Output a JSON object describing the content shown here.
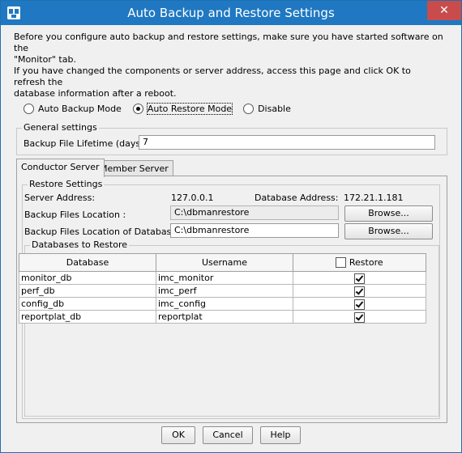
{
  "window": {
    "title": "Auto Backup and Restore Settings",
    "close_glyph": "✕"
  },
  "info": {
    "line1": "Before you configure auto backup and restore settings, make sure you have started software on the",
    "line2": "\"Monitor\" tab.",
    "line3": "If you have changed the components or server address, access this page and click OK to refresh the",
    "line4": "database information after a reboot."
  },
  "mode": {
    "options": [
      "Auto Backup Mode",
      "Auto Restore Mode",
      "Disable"
    ],
    "selected": "Auto Restore Mode"
  },
  "general": {
    "title": "General settings",
    "lifetime_label": "Backup File Lifetime (days):",
    "lifetime_value": "7"
  },
  "tabs": [
    "Conductor Server",
    "Member Server"
  ],
  "active_tab": "Conductor Server",
  "restore": {
    "title": "Restore Settings",
    "server_label": "Server Address:",
    "server_value": "127.0.0.1",
    "db_address_label": "Database Address:",
    "db_address_value": "172.21.1.181",
    "files_location_label": "Backup Files Location :",
    "files_location_value": "C:\\dbmanrestore",
    "files_db_label": "Backup Files Location of Database :",
    "files_db_value": "C:\\dbmanrestore",
    "browse_label": "Browse..."
  },
  "databases": {
    "title": "Databases to Restore",
    "columns": [
      "Database",
      "Username",
      "Restore"
    ],
    "header_restore_checked": false,
    "rows": [
      {
        "database": "monitor_db",
        "username": "imc_monitor",
        "restore": true
      },
      {
        "database": "perf_db",
        "username": "imc_perf",
        "restore": true
      },
      {
        "database": "config_db",
        "username": "imc_config",
        "restore": true
      },
      {
        "database": "reportplat_db",
        "username": "reportplat",
        "restore": true
      }
    ]
  },
  "buttons": {
    "ok": "OK",
    "cancel": "Cancel",
    "help": "Help"
  },
  "colors": {
    "titlebar": "#1f78c1",
    "close": "#c94c4c",
    "background": "#f0f0f0"
  },
  "icons": {
    "app": "app-icon",
    "close": "close-icon",
    "checkbox": "checkmark-icon"
  }
}
